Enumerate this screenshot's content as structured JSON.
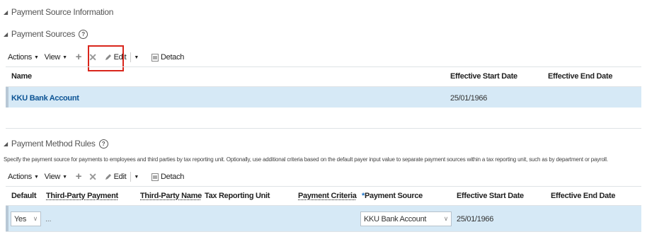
{
  "header": {
    "title": "Payment Source Information"
  },
  "payment_sources": {
    "title": "Payment Sources",
    "toolbar": {
      "actions": "Actions",
      "view": "View",
      "edit": "Edit",
      "detach": "Detach"
    },
    "columns": {
      "name": "Name",
      "start": "Effective Start Date",
      "end": "Effective End Date"
    },
    "rows": [
      {
        "name": "KKU Bank Account",
        "start": "25/01/1966",
        "end": ""
      }
    ]
  },
  "payment_method_rules": {
    "title": "Payment Method Rules",
    "description": "Specify the payment source for payments to employees and third parties by tax reporting unit. Optionally, use additional criteria based on the default payer input value to separate payment sources within a tax reporting unit, such as by department or payroll.",
    "toolbar": {
      "actions": "Actions",
      "view": "View",
      "edit": "Edit",
      "detach": "Detach"
    },
    "columns": {
      "default": "Default",
      "third_party_payment": "Third-Party Payment",
      "third_party_name": "Third-Party Name",
      "tax_reporting_unit": "Tax Reporting Unit",
      "payment_criteria": "Payment Criteria",
      "required_mark": "*",
      "payment_source": "Payment Source",
      "start": "Effective Start Date",
      "end": "Effective End Date"
    },
    "rows": [
      {
        "default": "Yes",
        "third_party_payment": "...",
        "payment_source": "KKU Bank Account",
        "start": "25/01/1966"
      }
    ]
  },
  "colors": {
    "highlight": "#d9261c",
    "selected_row": "#d6e9f6",
    "link": "#0b5394"
  },
  "icons": [
    "help-icon",
    "add-icon",
    "delete-icon",
    "edit-icon",
    "detach-icon",
    "dropdown-icon"
  ]
}
